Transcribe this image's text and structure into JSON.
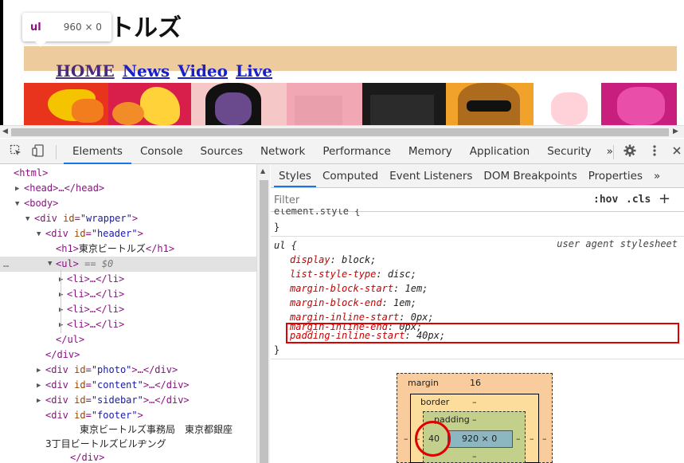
{
  "preview": {
    "site_title": "ートルズ",
    "nav": [
      "HOME",
      "News",
      "Video",
      "Live"
    ],
    "tooltip": {
      "tag": "ul",
      "size": "960 × 0"
    }
  },
  "toolbar": {
    "tabs": [
      "Elements",
      "Console",
      "Sources",
      "Network",
      "Performance",
      "Memory",
      "Application",
      "Security"
    ],
    "active_tab": "Elements",
    "more": "»"
  },
  "dom_tree": {
    "html": "<html>",
    "head": "<head>…</head>",
    "body": "<body>",
    "wrapper_tag": "<div",
    "wrapper_attr": "id",
    "wrapper_val": "\"wrapper\"",
    "header_val": "\"header\"",
    "h1_text": "東京ビートルズ",
    "ul_eq": "== $0",
    "li": "<li>…</li>",
    "ul_close": "</ul>",
    "div_close": "</div>",
    "photo_val": "\"photo\"",
    "content_val": "\"content\"",
    "sidebar_val": "\"sidebar\"",
    "footer_val": "\"footer\"",
    "footer_text_1": "東京ビートルズ事務局　東京都銀座",
    "footer_text_2": "3丁目ビートルズビルヂング",
    "ellipsis": "…"
  },
  "styles": {
    "tabs": [
      "Styles",
      "Computed",
      "Event Listeners",
      "DOM Breakpoints",
      "Properties"
    ],
    "active_tab": "Styles",
    "more": "»",
    "filter_placeholder": "Filter",
    "hov": ":hov",
    "cls": ".cls",
    "plus": "+",
    "element_style": "element.style {",
    "brace_close": "}",
    "rule_selector": "ul {",
    "rule_source": "user agent stylesheet",
    "declarations": [
      {
        "prop": "display",
        "value": "block;"
      },
      {
        "prop": "list-style-type",
        "value": "disc;"
      },
      {
        "prop": "margin-block-start",
        "value": "1em;"
      },
      {
        "prop": "margin-block-end",
        "value": "1em;"
      },
      {
        "prop": "margin-inline-start",
        "value": "0px;"
      },
      {
        "prop": "margin-inline-end",
        "value": "0px;"
      },
      {
        "prop": "padding-inline-start",
        "value": "40px;"
      }
    ]
  },
  "box_model": {
    "margin_label": "margin",
    "margin_value": "16",
    "border_label": "border",
    "border_value": "–",
    "padding_label": "padding",
    "padding_value": "–",
    "padding_left": "40",
    "content_size": "920 × 0",
    "dash": "–"
  },
  "colors": {
    "accent": "#1a73e8",
    "highlight": "#e00000",
    "nav_bar": "#eecb9c"
  }
}
